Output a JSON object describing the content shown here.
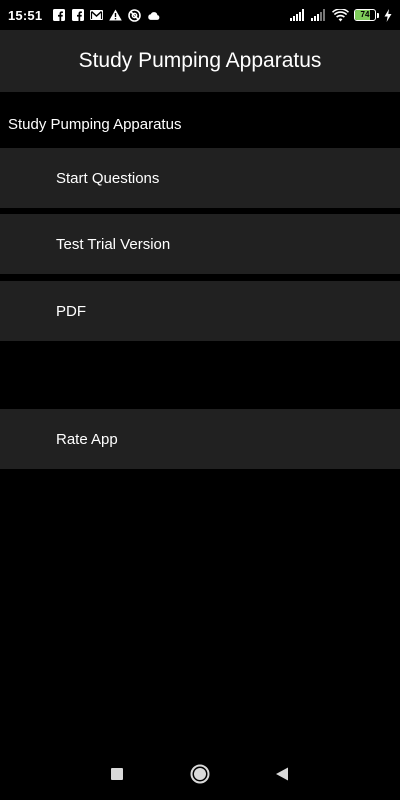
{
  "status_bar": {
    "time": "15:51",
    "battery_level": "74",
    "battery_fraction": 0.74,
    "battery_color": "#7ecb5a",
    "left_icons": [
      "facebook-icon",
      "facebook-icon",
      "gmail-icon",
      "warning-icon",
      "do-not-disturb-icon",
      "cloud-icon"
    ],
    "right_icons": [
      "signal-icon",
      "signal-icon",
      "wifi-icon",
      "battery-icon",
      "charging-icon"
    ]
  },
  "app_bar": {
    "title": "Study Pumping Apparatus",
    "background": "#212121"
  },
  "section": {
    "label": "Study Pumping Apparatus"
  },
  "menu": {
    "items": [
      {
        "label": "Start Questions"
      },
      {
        "label": "Test Trial Version"
      },
      {
        "label": "PDF"
      },
      {
        "label": "Rate App"
      }
    ]
  },
  "nav_bar": {
    "buttons": [
      "recents-icon",
      "home-icon",
      "back-icon"
    ]
  }
}
